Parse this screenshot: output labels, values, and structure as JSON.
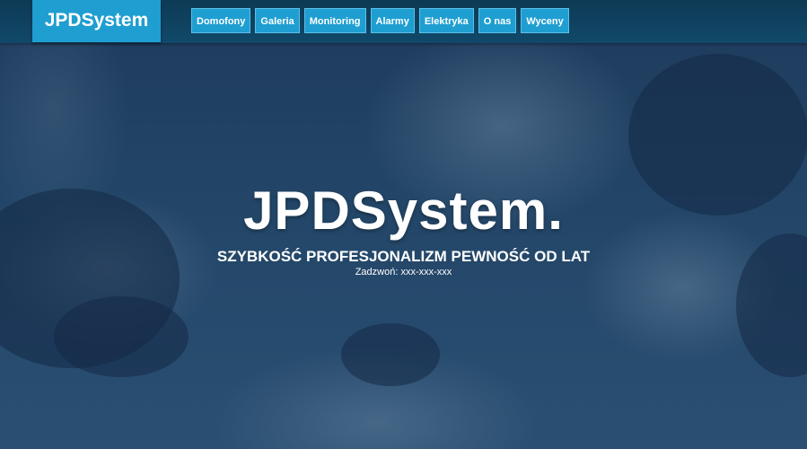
{
  "header": {
    "brand": "JPDSystem",
    "nav": [
      {
        "label": "Domofony"
      },
      {
        "label": "Galeria"
      },
      {
        "label": "Monitoring"
      },
      {
        "label": "Alarmy"
      },
      {
        "label": "Elektryka"
      },
      {
        "label": "O nas"
      },
      {
        "label": "Wyceny"
      }
    ]
  },
  "hero": {
    "title": "JPDSystem.",
    "tagline": "SZYBKOŚĆ PROFESJONALIZM PEWNOŚĆ OD LAT",
    "phone": "Zadzwoń: xxx-xxx-xxx"
  },
  "colors": {
    "navbar": "#11496a",
    "accent": "#1f9ed1",
    "overlay": "#1f3d5e"
  }
}
